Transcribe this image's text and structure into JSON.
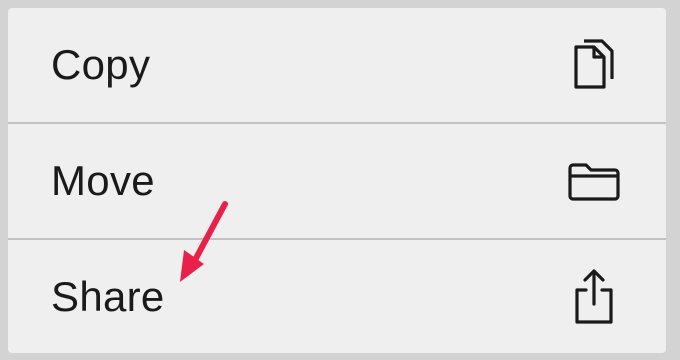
{
  "menu": {
    "items": [
      {
        "label": "Copy",
        "icon": "copy-icon"
      },
      {
        "label": "Move",
        "icon": "folder-icon"
      },
      {
        "label": "Share",
        "icon": "share-icon"
      }
    ]
  },
  "colors": {
    "background": "#d3d3d3",
    "menu": "#efefef",
    "divider": "#c2c2c4",
    "text": "#1a1a1a",
    "annotation_arrow": "#e8214a"
  }
}
